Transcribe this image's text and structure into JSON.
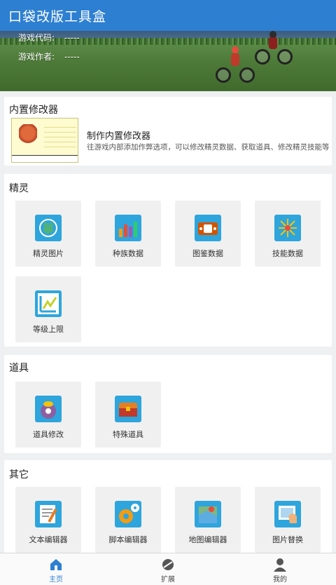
{
  "app": {
    "title": "口袋改版工具盒"
  },
  "banner": {
    "game_code_label": "游戏代码:",
    "game_code_value": "-----",
    "game_author_label": "游戏作者:",
    "game_author_value": "-----"
  },
  "builtin_editor": {
    "section_title": "内置修改器",
    "item_name": "制作内置修改器",
    "item_desc": "往游戏内部添加作弊选项，可以修改精灵数据、获取道具、修改精灵技能等"
  },
  "sprites": {
    "section_title": "精灵",
    "items": [
      {
        "label": "精灵图片",
        "icon": "pokemon-image-icon"
      },
      {
        "label": "种族数据",
        "icon": "bar-chart-icon"
      },
      {
        "label": "图鉴数据",
        "icon": "pokedex-icon"
      },
      {
        "label": "技能数据",
        "icon": "sparkle-icon"
      },
      {
        "label": "等级上限",
        "icon": "level-up-icon"
      }
    ]
  },
  "items_section": {
    "section_title": "道具",
    "items": [
      {
        "label": "道具修改",
        "icon": "bag-icon"
      },
      {
        "label": "特殊道具",
        "icon": "treasure-chest-icon"
      }
    ]
  },
  "other": {
    "section_title": "其它",
    "items": [
      {
        "label": "文本编辑器",
        "icon": "text-editor-icon"
      },
      {
        "label": "脚本编辑器",
        "icon": "gears-icon"
      },
      {
        "label": "地图编辑器",
        "icon": "map-icon"
      },
      {
        "label": "图片替换",
        "icon": "image-replace-icon"
      }
    ]
  },
  "tabs": [
    {
      "label": "主页",
      "icon": "home-icon",
      "active": true
    },
    {
      "label": "扩展",
      "icon": "extension-icon",
      "active": false
    },
    {
      "label": "我的",
      "icon": "user-icon",
      "active": false
    }
  ],
  "colors": {
    "primary": "#2d7fd1",
    "icon_bg": "#2ea5dc",
    "tile_bg": "#f0f0f0"
  }
}
